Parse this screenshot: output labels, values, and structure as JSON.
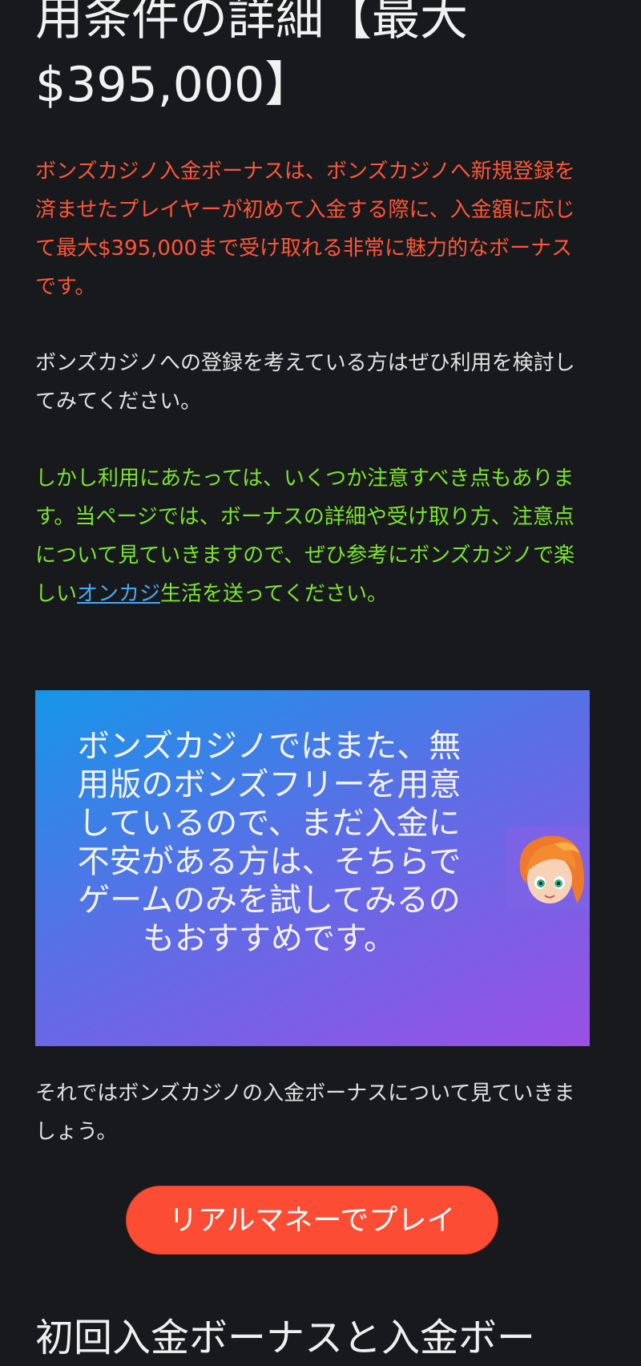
{
  "heading": {
    "line1": "用条件の詳細【最大",
    "line2": "$395,000】"
  },
  "intro_red": "ボンズカジノ入金ボーナスは、ボンズカジノへ新規登録を済ませたプレイヤーが初めて入金する際に、入金額に応じて最大$395,000まで受け取れる非常に魅力的なボーナスです。",
  "intro_white": "ボンズカジノへの登録を考えている方はぜひ利用を検討してみてください。",
  "notice_green": {
    "before": "しかし利用にあたっては、いくつか注意すべき点もあります。当ページでは、ボーナスの詳細や受け取り方、注意点について見ていきますので、ぜひ参考にボンズカジノで楽しい",
    "link": "オンカジ",
    "after": "生活を送ってください。"
  },
  "banner": {
    "text": "ボンズカジノではまた、無用版のボンズフリーを用意しているので、まだ入金に不安がある方は、そちらでゲームのみを試してみるのもおすすめです。",
    "avatar_icon": "cartoon-girl-avatar"
  },
  "outro_white": "それではボンズカジノの入金ボーナスについて見ていきましょう。",
  "cta_label": "リアルマネーでプレイ",
  "next_heading": "初回入金ボーナスと入金ボー",
  "colors": {
    "background": "#18191c",
    "red_text": "#ff5638",
    "green_text": "#7be52c",
    "link": "#46aaf5",
    "cta": "#fc4d34"
  }
}
